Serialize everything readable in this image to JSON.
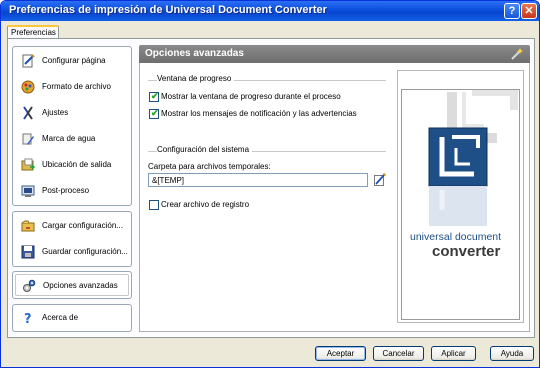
{
  "window": {
    "title": "Preferencias de impresión de Universal Document Converter"
  },
  "tabs": [
    {
      "label": "Preferencias"
    }
  ],
  "sidebar": {
    "group1": [
      {
        "label": "Configurar página",
        "icon": "page-setup-icon"
      },
      {
        "label": "Formato de archivo",
        "icon": "file-format-icon"
      },
      {
        "label": "Ajustes",
        "icon": "adjustments-icon"
      },
      {
        "label": "Marca de agua",
        "icon": "watermark-icon"
      },
      {
        "label": "Ubicación de salida",
        "icon": "output-folder-icon"
      },
      {
        "label": "Post-proceso",
        "icon": "post-process-icon"
      }
    ],
    "group2": [
      {
        "label": "Cargar configuración...",
        "icon": "load-config-icon"
      },
      {
        "label": "Guardar configuración...",
        "icon": "save-config-icon"
      }
    ],
    "group3": [
      {
        "label": "Opciones avanzadas",
        "icon": "advanced-options-icon"
      }
    ],
    "group4": [
      {
        "label": "Acerca de",
        "icon": "help-icon"
      }
    ]
  },
  "panel": {
    "title": "Opciones avanzadas",
    "progress_group": "Ventana de progreso",
    "show_progress_label": "Mostrar la ventana de progreso durante el proceso",
    "show_progress_checked": true,
    "show_notifications_label": "Mostrar los mensajes de notificación y las advertencias",
    "show_notifications_checked": true,
    "system_group": "Configuración del sistema",
    "temp_folder_label": "Carpeta para archivos temporales:",
    "temp_folder_value": "&[TEMP]",
    "log_file_label": "Crear archivo de registro",
    "log_file_checked": false
  },
  "logo": {
    "line1": "universal document",
    "line2": "converter"
  },
  "colors": {
    "titlebar": "#0a46d0",
    "logo_blue": "#1e4f86",
    "header": "#7a7a7a"
  },
  "buttons": {
    "ok": "Aceptar",
    "cancel": "Cancelar",
    "apply": "Aplicar",
    "help": "Ayuda"
  }
}
